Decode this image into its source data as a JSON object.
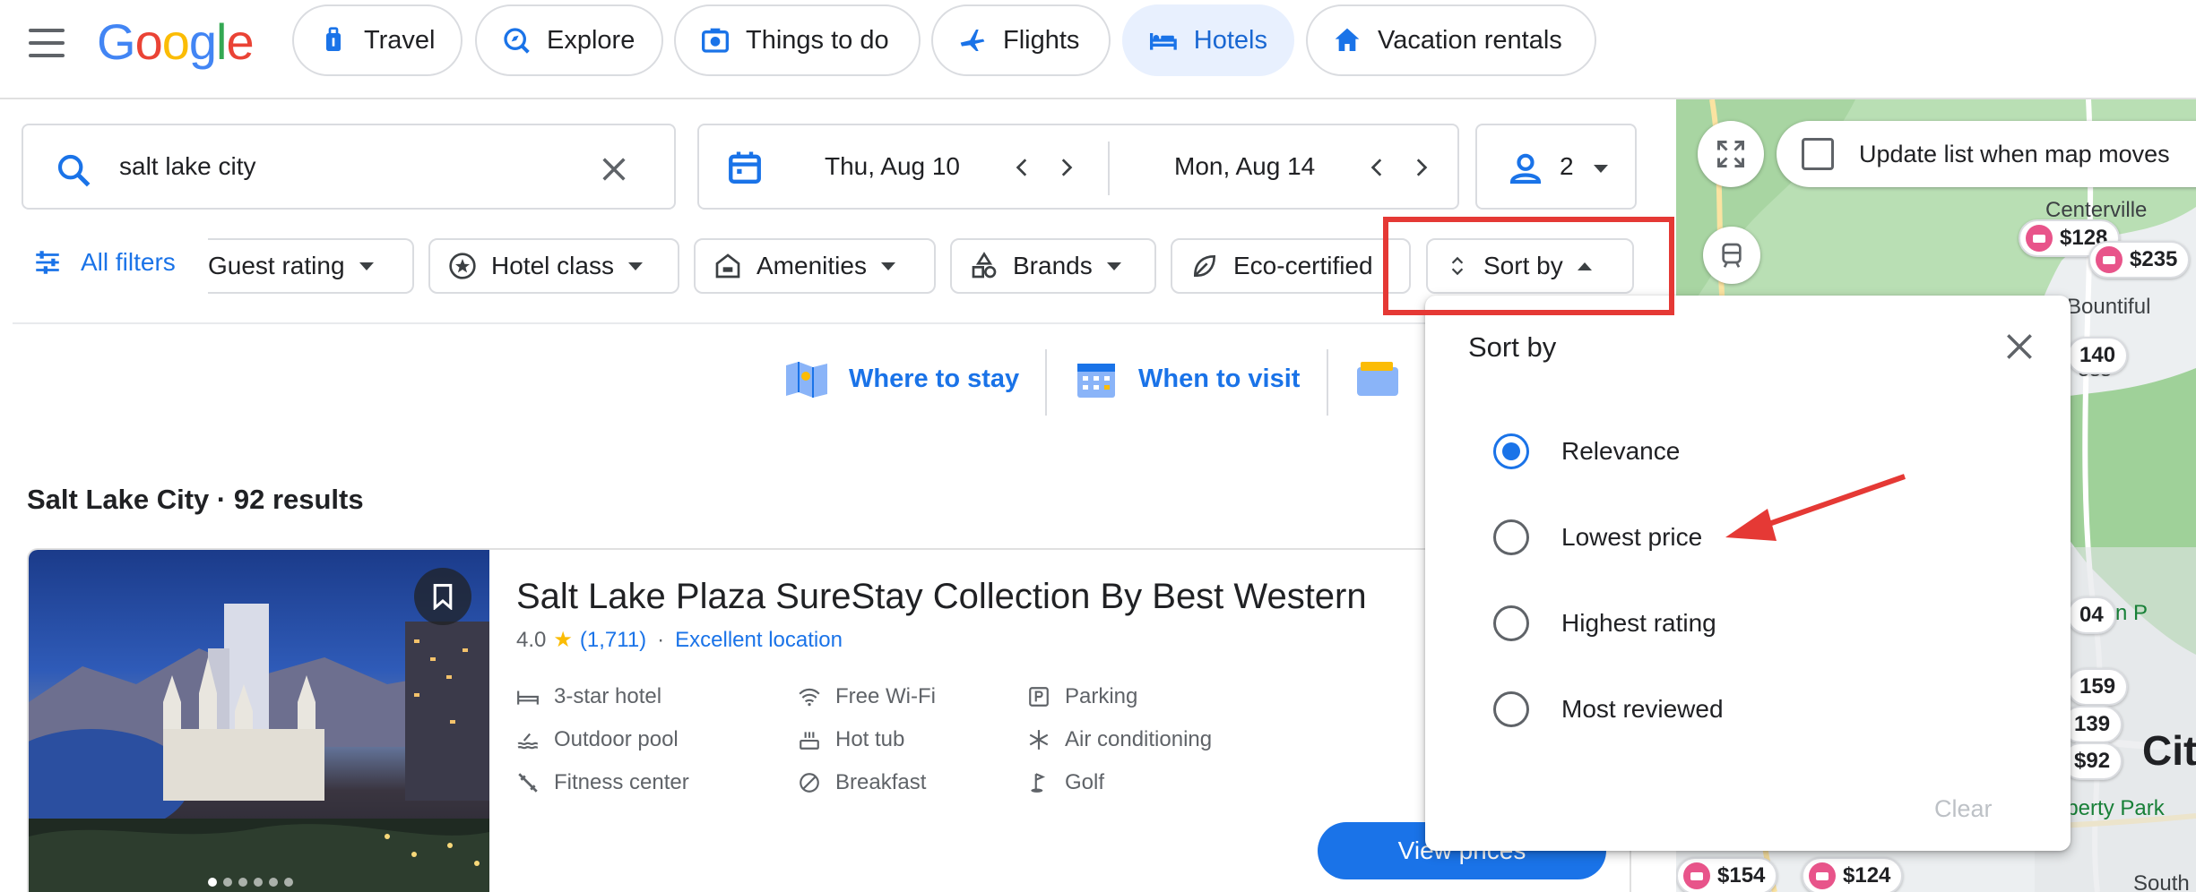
{
  "header": {
    "logo": "Google",
    "nav": [
      {
        "label": "Travel",
        "icon": "luggage-icon"
      },
      {
        "label": "Explore",
        "icon": "explore-icon"
      },
      {
        "label": "Things to do",
        "icon": "things-to-do-icon"
      },
      {
        "label": "Flights",
        "icon": "flight-icon"
      },
      {
        "label": "Hotels",
        "icon": "hotel-icon",
        "active": true
      },
      {
        "label": "Vacation rentals",
        "icon": "home-icon"
      }
    ]
  },
  "search": {
    "query": "salt lake city",
    "checkin": "Thu, Aug 10",
    "checkout": "Mon, Aug 14",
    "guests": "2"
  },
  "filters": {
    "all_filters": "All filters",
    "chips": [
      "Guest rating",
      "Hotel class",
      "Amenities",
      "Brands",
      "Eco-certified"
    ],
    "sort_by": "Sort by"
  },
  "quick_links": [
    "Where to stay",
    "When to visit"
  ],
  "results": {
    "heading": "Salt Lake City · 92 results"
  },
  "hotel": {
    "name": "Salt Lake Plaza SureStay Collection By Best Western",
    "rating": "4.0",
    "star": "★",
    "reviews": "(1,711)",
    "separator": "·",
    "badge": "Excellent location",
    "amenities": [
      {
        "label": "3-star hotel",
        "icon": "hotel-class-icon"
      },
      {
        "label": "Outdoor pool",
        "icon": "pool-icon"
      },
      {
        "label": "Fitness center",
        "icon": "fitness-icon"
      },
      {
        "label": "Free Wi-Fi",
        "icon": "wifi-icon"
      },
      {
        "label": "Hot tub",
        "icon": "hot-tub-icon"
      },
      {
        "label": "Breakfast",
        "icon": "no-breakfast-icon"
      },
      {
        "label": "Parking",
        "icon": "parking-icon"
      },
      {
        "label": "Air conditioning",
        "icon": "snowflake-icon"
      },
      {
        "label": "Golf",
        "icon": "golf-icon"
      }
    ],
    "cta": "View prices"
  },
  "map": {
    "update_label": "Update list when map moves",
    "places": [
      "Centerville",
      "Bountiful",
      "oss",
      "Ensign P",
      "iberty Park",
      "South",
      "Cit"
    ],
    "prices": [
      "$128",
      "$235",
      "140",
      "04",
      "159",
      "139",
      "$92",
      "$154",
      "$124"
    ]
  },
  "sort_popup": {
    "title": "Sort by",
    "options": [
      "Relevance",
      "Lowest price",
      "Highest rating",
      "Most reviewed"
    ],
    "selected": 0,
    "clear": "Clear"
  },
  "colors": {
    "accent": "#1a73e8",
    "annotation_red": "#e53935",
    "map_green": "#a8d5a2"
  }
}
